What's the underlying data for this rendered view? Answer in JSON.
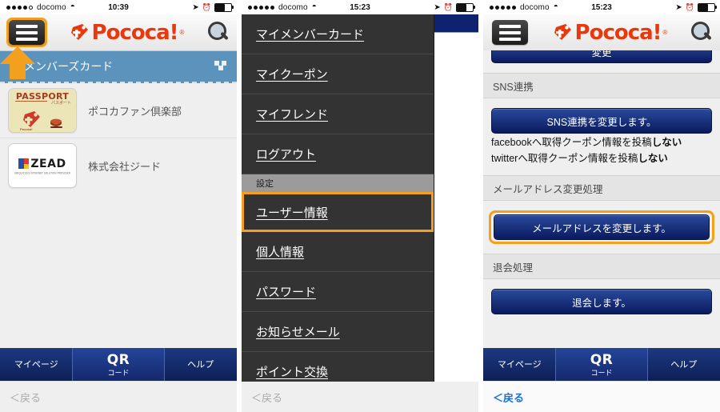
{
  "panels": [
    {
      "status": {
        "carrier": "docomo",
        "time": "10:39",
        "signal_filled": 4,
        "signal_total": 5,
        "battery_pct": 60
      },
      "header": {
        "logo_text": "Pococa!",
        "logo_reg": "®",
        "menu_icon": "hamburger-icon",
        "search_icon": "search-icon"
      },
      "section_bar": {
        "title": "メンバーズカード"
      },
      "cards": [
        {
          "thumb_title": "PASSPORT",
          "thumb_sub": "パスポート",
          "thumb_brand": "Pococa!",
          "label": "ポコカファン倶楽部"
        },
        {
          "thumb_title": "ZEAD",
          "thumb_sub": "UBIQUITOUS INTERNET SOLUTION PROVIDER",
          "label": "株式会社ジード"
        }
      ],
      "bottom_nav": [
        {
          "label": "マイページ"
        },
        {
          "label_main": "QR",
          "label_sub": "コード"
        },
        {
          "label": "ヘルプ"
        }
      ],
      "back": {
        "label": "＜戻る",
        "color": "#a9a9a9"
      }
    },
    {
      "status": {
        "carrier": "docomo",
        "time": "15:23",
        "signal_filled": 5,
        "signal_total": 5,
        "battery_pct": 60
      },
      "menu_items": [
        {
          "label": "マイメンバーカード",
          "type": "item",
          "highlighted": false
        },
        {
          "label": "マイクーポン",
          "type": "item",
          "highlighted": false
        },
        {
          "label": "マイフレンド",
          "type": "item",
          "highlighted": false
        },
        {
          "label": "ログアウト",
          "type": "item",
          "highlighted": false
        },
        {
          "label": "設定",
          "type": "section",
          "highlighted": false
        },
        {
          "label": "ユーザー情報",
          "type": "item",
          "highlighted": true
        },
        {
          "label": "個人情報",
          "type": "item",
          "highlighted": false
        },
        {
          "label": "パスワード",
          "type": "item",
          "highlighted": false
        },
        {
          "label": "お知らせメール",
          "type": "item",
          "highlighted": false
        },
        {
          "label": "ポイント交換",
          "type": "item",
          "highlighted": false
        }
      ],
      "back": {
        "label": "＜戻る",
        "color": "#a9a9a9"
      }
    },
    {
      "status": {
        "carrier": "docomo",
        "time": "15:23",
        "signal_filled": 5,
        "signal_total": 5,
        "battery_pct": 60
      },
      "header": {
        "logo_text": "Pococa!",
        "logo_reg": "®",
        "menu_icon": "hamburger-icon",
        "search_icon": "search-icon"
      },
      "top_button": {
        "label": "変更"
      },
      "sections": [
        {
          "heading": "SNS連携",
          "button": "SNS連携を変更します。",
          "highlighted": false,
          "notes": [
            {
              "prefix": "facebookへ取得クーポン情報を投稿",
              "strong": "しない"
            },
            {
              "prefix": "twitterへ取得クーポン情報を投稿",
              "strong": "しない"
            }
          ]
        },
        {
          "heading": "メールアドレス変更処理",
          "button": "メールアドレスを変更します。",
          "highlighted": true,
          "notes": []
        },
        {
          "heading": "退会処理",
          "button": "退会します。",
          "highlighted": false,
          "notes": []
        }
      ],
      "bottom_nav": [
        {
          "label": "マイページ"
        },
        {
          "label_main": "QR",
          "label_sub": "コード"
        },
        {
          "label": "ヘルプ"
        }
      ],
      "back": {
        "label": "＜戻る",
        "color": "#1a6fd4"
      }
    }
  ],
  "colors": {
    "highlight": "#f2a01d",
    "brand_red": "#e8380d",
    "nav_blue": "#14286b",
    "bar_blue": "#5b93bd"
  }
}
